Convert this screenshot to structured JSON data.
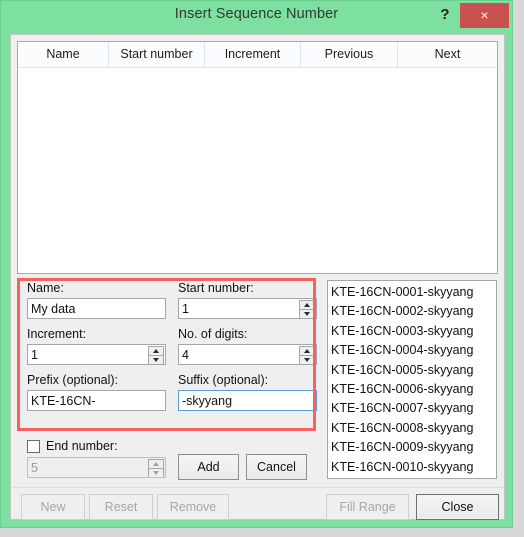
{
  "window": {
    "title": "Insert Sequence Number",
    "help_label": "?",
    "close_label": "×",
    "accent_green": "#7ee0a0",
    "close_red": "#c9514f",
    "annotation_red": "#f9615c",
    "focus_blue": "#5a9fd4"
  },
  "grid": {
    "columns": [
      "Name",
      "Start number",
      "Increment",
      "Previous",
      "Next"
    ],
    "rows": []
  },
  "form": {
    "name": {
      "label": "Name:",
      "value": "My data"
    },
    "start_number": {
      "label": "Start number:",
      "value": "1"
    },
    "increment": {
      "label": "Increment:",
      "value": "1"
    },
    "digits": {
      "label": "No. of digits:",
      "value": "4"
    },
    "prefix": {
      "label": "Prefix (optional):",
      "value": "KTE-16CN-"
    },
    "suffix": {
      "label": "Suffix (optional):",
      "value": "-skyyang"
    },
    "end_number": {
      "label": "End number:",
      "value": "5",
      "checked": false
    }
  },
  "actions": {
    "add": "Add",
    "cancel": "Cancel"
  },
  "preview": {
    "items": [
      "KTE-16CN-0001-skyyang",
      "KTE-16CN-0002-skyyang",
      "KTE-16CN-0003-skyyang",
      "KTE-16CN-0004-skyyang",
      "KTE-16CN-0005-skyyang",
      "KTE-16CN-0006-skyyang",
      "KTE-16CN-0007-skyyang",
      "KTE-16CN-0008-skyyang",
      "KTE-16CN-0009-skyyang",
      "KTE-16CN-0010-skyyang"
    ]
  },
  "footer": {
    "new": "New",
    "reset": "Reset",
    "remove": "Remove",
    "fill_range": "Fill Range",
    "close": "Close"
  }
}
